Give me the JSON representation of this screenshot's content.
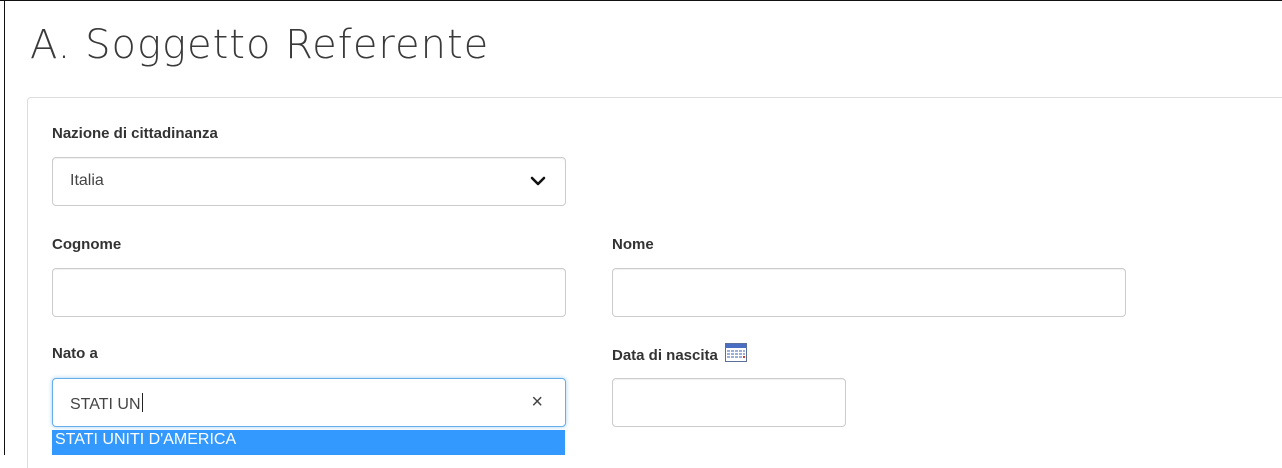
{
  "section": {
    "title": "A. Soggetto Referente"
  },
  "fields": {
    "nazione": {
      "label": "Nazione di cittadinanza",
      "value": "Italia"
    },
    "cognome": {
      "label": "Cognome",
      "value": ""
    },
    "nome": {
      "label": "Nome",
      "value": ""
    },
    "nato_a": {
      "label": "Nato a",
      "value": "STATI UN",
      "clear_symbol": "×"
    },
    "data_nascita": {
      "label": "Data di nascita",
      "value": ""
    }
  },
  "autocomplete": {
    "options": [
      "STATI UNITI D'AMERICA"
    ]
  },
  "icons": {
    "select_chevron": "chevron-down-icon",
    "clear": "close-icon",
    "calendar": "calendar-icon"
  },
  "colors": {
    "highlight": "#3399ff",
    "focus_border": "#66afe9"
  }
}
